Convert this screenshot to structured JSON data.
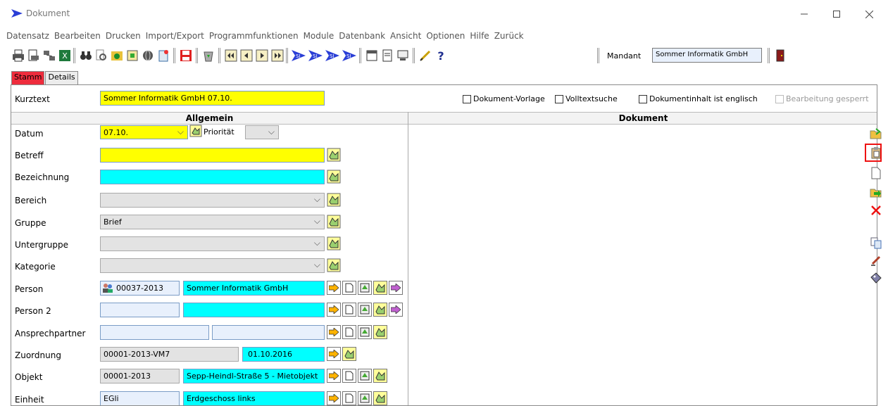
{
  "window": {
    "title": "Dokument"
  },
  "menu": [
    "Datensatz",
    "Bearbeiten",
    "Drucken",
    "Import/Export",
    "Programmfunktionen",
    "Module",
    "Datenbank",
    "Ansicht",
    "Optionen",
    "Hilfe",
    "Zurück"
  ],
  "toolbar": {
    "mandant_label": "Mandant",
    "mandant_value": "Sommer Informatik GmbH"
  },
  "tabs": [
    {
      "label": "Stamm",
      "active": true
    },
    {
      "label": "Details",
      "active": false
    }
  ],
  "kurztext": {
    "label": "Kurztext",
    "value": "Sommer Informatik GmbH 07.10."
  },
  "checkboxes": [
    {
      "label": "Dokument-Vorlage",
      "checked": false,
      "enabled": true
    },
    {
      "label": "Volltextsuche",
      "checked": false,
      "enabled": true
    },
    {
      "label": "Dokumentinhalt ist englisch",
      "checked": false,
      "enabled": true
    },
    {
      "label": "Bearbeitung gesperrt",
      "checked": false,
      "enabled": false
    }
  ],
  "sections": {
    "left": "Allgemein",
    "right": "Dokument"
  },
  "fields": {
    "datum": {
      "label": "Datum",
      "value": "07.10."
    },
    "prioritaet": {
      "label": "Priorität",
      "value": ""
    },
    "betreff": {
      "label": "Betreff",
      "value": ""
    },
    "bezeichnung": {
      "label": "Bezeichnung",
      "value": ""
    },
    "bereich": {
      "label": "Bereich",
      "value": ""
    },
    "gruppe": {
      "label": "Gruppe",
      "value": "Brief"
    },
    "untergruppe": {
      "label": "Untergruppe",
      "value": ""
    },
    "kategorie": {
      "label": "Kategorie",
      "value": ""
    },
    "person": {
      "label": "Person",
      "nr": "00037-2013",
      "name": "Sommer Informatik GmbH"
    },
    "person2": {
      "label": "Person 2",
      "nr": "",
      "name": ""
    },
    "ansprechpartner": {
      "label": "Ansprechpartner",
      "v1": "",
      "v2": ""
    },
    "zuordnung": {
      "label": "Zuordnung",
      "nr": "00001-2013-VM7",
      "date": "01.10.2016"
    },
    "objekt": {
      "label": "Objekt",
      "nr": "00001-2013",
      "name": "Sepp-Heindl-Straße 5 - Mietobjekt"
    },
    "einheit": {
      "label": "Einheit",
      "nr": "EGli",
      "name": "Erdgeschoss links"
    }
  },
  "colors": {
    "yellow": "#ffff00",
    "cyan": "#00ffff",
    "tab_active": "#ee2c3c",
    "highlight": "#e11111"
  }
}
